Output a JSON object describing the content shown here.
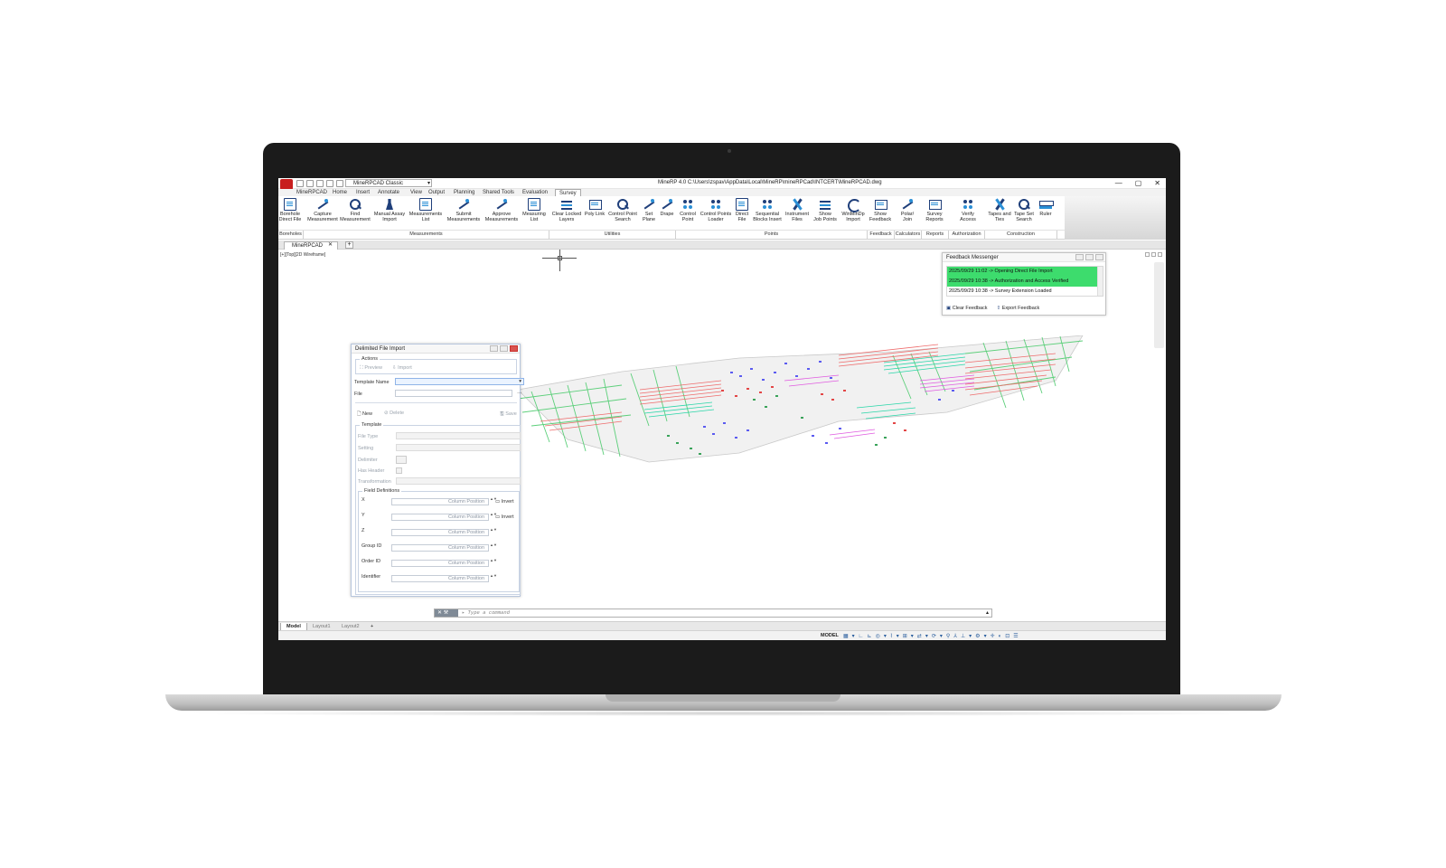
{
  "app": {
    "workspace": "MineRPCAD Classic",
    "window_title": "MineRP 4.0   C:\\Users\\zspav\\AppData\\Local\\MineRP\\mineRPCad\\INTCERT\\MineRPCAD.dwg",
    "window_controls": [
      "—",
      "▢",
      "✕"
    ]
  },
  "menu_tabs": [
    "MineRPCAD",
    "Home",
    "Insert",
    "Annotate",
    "View",
    "Output",
    "Planning",
    "Shared Tools",
    "Evaluation",
    "Survey"
  ],
  "active_tab": "Survey",
  "ribbon": {
    "buttons": [
      {
        "label": "Borehole\nDirect File",
        "icon": "doc-icon"
      },
      {
        "label": "Capture\nMeasurement",
        "icon": "line-icon"
      },
      {
        "label": "Find\nMeasurement",
        "icon": "search-icon"
      },
      {
        "label": "Manual Assay\nImport",
        "icon": "flask-icon"
      },
      {
        "label": "Measurements\nList",
        "icon": "doc-icon"
      },
      {
        "label": "Submit\nMeasurements",
        "icon": "line-icon"
      },
      {
        "label": "Approve\nMeasurements",
        "icon": "line-icon"
      },
      {
        "label": "Measuring\nList",
        "icon": "doc-icon"
      },
      {
        "label": "Clear Locked\nLayers",
        "icon": "layers-icon"
      },
      {
        "label": "Poly Link",
        "icon": "screen-icon"
      },
      {
        "label": "Control Point\nSearch",
        "icon": "search-icon"
      },
      {
        "label": "Set\nPlane",
        "icon": "line-icon"
      },
      {
        "label": "Drape",
        "icon": "line-icon"
      },
      {
        "label": "Control\nPoint",
        "icon": "points-icon"
      },
      {
        "label": "Control Points\nLoader",
        "icon": "points-icon"
      },
      {
        "label": "Direct\nFile",
        "icon": "doc-icon"
      },
      {
        "label": "Sequential\nBlocks Insert",
        "icon": "points-icon"
      },
      {
        "label": "Instrument\nFiles",
        "icon": "tool-icon"
      },
      {
        "label": "Show\nJob Points",
        "icon": "bars-icon"
      },
      {
        "label": "WinMinDp\nImport",
        "icon": "arc-icon"
      },
      {
        "label": "Show\nFeedback",
        "icon": "screen-icon"
      },
      {
        "label": "Polar/\nJoin",
        "icon": "line-icon"
      },
      {
        "label": "Survey\nReports",
        "icon": "screen-icon"
      },
      {
        "label": "Verify\nAccess",
        "icon": "gear-icon"
      },
      {
        "label": "Tapes and\nTies",
        "icon": "tool-icon"
      },
      {
        "label": "Tape Set\nSearch",
        "icon": "search-icon"
      },
      {
        "label": "Ruler",
        "icon": "ruler-icon"
      }
    ],
    "groups": [
      "Boreholes",
      "Measurements",
      "Utilities",
      "Points",
      "Feedback",
      "Calculators",
      "Reports",
      "Authorization",
      "Construction"
    ]
  },
  "document": {
    "tab": "MineRPCAD",
    "view_label": "[+][Top][2D Wireframe]"
  },
  "dialog": {
    "title": "Delimited File Import",
    "actions_legend": "Actions",
    "preview": "Preview",
    "import": "Import",
    "template_name_label": "Template Name",
    "file_label": "File",
    "new": "New",
    "delete": "Delete",
    "save": "Save",
    "template_legend": "Template",
    "file_type": "File Type",
    "setting": "Setting",
    "delimiter": "Delimiter",
    "has_header": "Has Header",
    "transformation": "Transformation",
    "field_defs_legend": "Field Definitions",
    "fields": [
      {
        "label": "X",
        "placeholder": "Column Position",
        "invert": "Invert"
      },
      {
        "label": "Y",
        "placeholder": "Column Position",
        "invert": "Invert"
      },
      {
        "label": "Z",
        "placeholder": "Column Position"
      },
      {
        "label": "Group ID",
        "placeholder": "Column Position"
      },
      {
        "label": "Order ID",
        "placeholder": "Column Position"
      },
      {
        "label": "Identifier",
        "placeholder": "Column Position"
      }
    ]
  },
  "feedback": {
    "title": "Feedback Messenger",
    "messages": [
      {
        "text": "2025/09/29 11:02 -> Opening Direct File Import",
        "highlight": true
      },
      {
        "text": "2025/09/29 10:38 -> Authorization and Access Verified",
        "highlight": true
      },
      {
        "text": "2025/09/29 10:38 -> Survey Extension Loaded",
        "highlight": false
      }
    ],
    "clear": "Clear Feedback",
    "export": "Export Feedback"
  },
  "command": {
    "placeholder": "Type a command",
    "prompt_icon": "▸"
  },
  "layout_tabs": [
    "Model",
    "Layout1",
    "Layout2"
  ],
  "status": {
    "space": "MODEL"
  },
  "colors": {
    "accent": "#1f3f7a",
    "highlight": "#3ddc6d",
    "brand_red": "#c81e1e"
  }
}
